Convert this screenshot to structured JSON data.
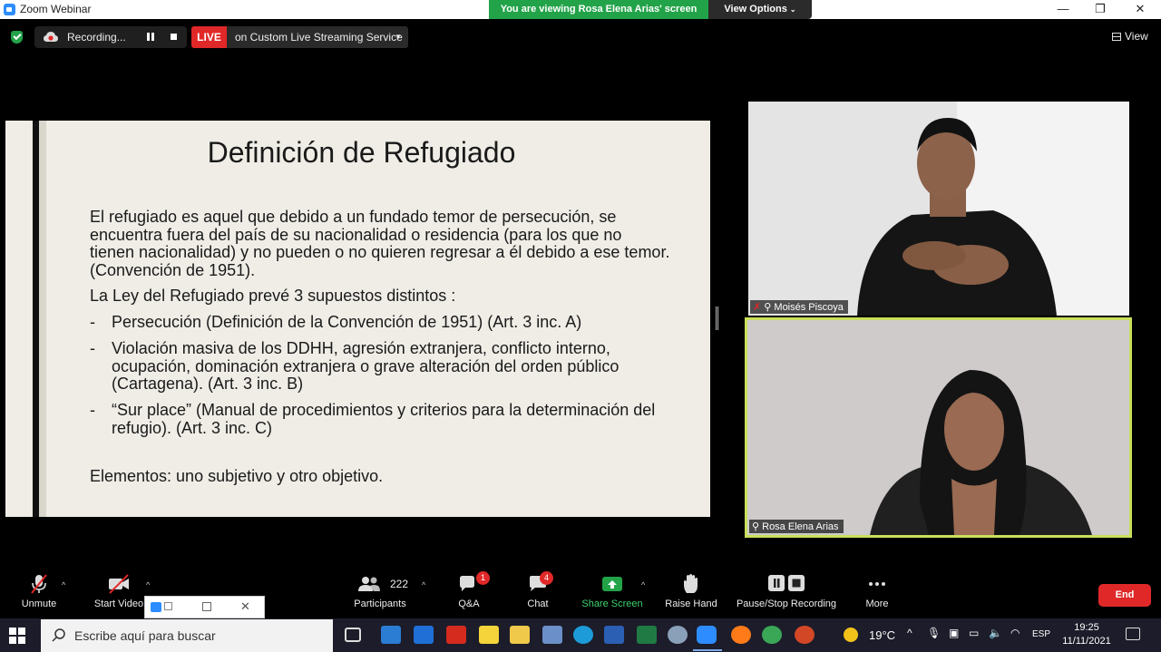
{
  "window": {
    "title": "Zoom Webinar"
  },
  "share_banner": {
    "text": "You are viewing Rosa Elena Arias' screen",
    "view_options": "View Options"
  },
  "window_controls": {
    "minimize": "—",
    "restore": "❐",
    "close": "✕"
  },
  "status": {
    "recording_label": "Recording...",
    "live_badge": "LIVE",
    "stream_service": "on Custom Live Streaming Service",
    "view_label": "View"
  },
  "slide": {
    "title": "Definición de Refugiado",
    "paragraph1": "El refugiado es aquel que debido a un fundado temor de persecución, se encuentra fuera del país de su nacionalidad o residencia (para los que no tienen nacionalidad) y no pueden o no quieren regresar a él debido a ese temor.  (Convención de 1951).",
    "paragraph2": "La Ley del Refugiado prevé 3 supuestos distintos :",
    "bullets": [
      "Persecución (Definición de la Convención de 1951) (Art. 3 inc. A)",
      "Violación masiva de los DDHH, agresión extranjera, conflicto interno, ocupación, dominación extranjera o grave alteración del orden público (Cartagena). (Art. 3 inc. B)",
      "“Sur place” (Manual de procedimientos y criterios para la determinación del refugio). (Art. 3 inc. C)"
    ],
    "bullet_marker": "-",
    "paragraph3": "Elementos: uno subjetivo y otro objetivo."
  },
  "participants_video": [
    {
      "name": "Moisés Piscoya"
    },
    {
      "name": "Rosa Elena Arias"
    }
  ],
  "toolbar": {
    "unmute": "Unmute",
    "start_video": "Start Video",
    "participants_label": "Participants",
    "participants_count": "222",
    "qa_label": "Q&A",
    "qa_badge": "1",
    "chat_label": "Chat",
    "chat_badge": "4",
    "share_screen": "Share Screen",
    "raise_hand": "Raise Hand",
    "pause_stop_recording": "Pause/Stop Recording",
    "more": "More",
    "end": "End"
  },
  "taskbar": {
    "search_placeholder": "Escribe aquí para buscar",
    "temperature": "19°C",
    "language": "ESP",
    "time": "19:25",
    "date": "11/11/2021"
  },
  "colors": {
    "live_red": "#e02828",
    "share_green": "#23a349",
    "active_speaker_border": "#c8e05a"
  }
}
